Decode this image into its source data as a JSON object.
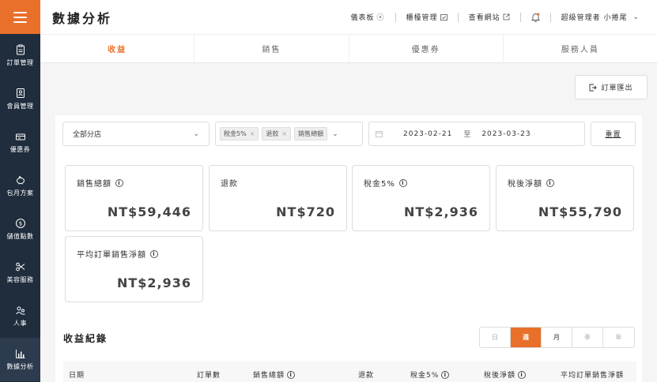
{
  "sidebar": {
    "items": [
      {
        "label": "訂單管理",
        "icon": "clipboard-icon"
      },
      {
        "label": "會員管理",
        "icon": "member-card-icon"
      },
      {
        "label": "優惠券",
        "icon": "coupon-icon"
      },
      {
        "label": "包月方案",
        "icon": "piggy-bank-icon"
      },
      {
        "label": "儲值點數",
        "icon": "dollar-coin-icon"
      },
      {
        "label": "美容服務",
        "icon": "scissors-icon"
      },
      {
        "label": "人事",
        "icon": "people-icon"
      },
      {
        "label": "數據分析",
        "icon": "bar-chart-icon"
      }
    ],
    "active_index": 7
  },
  "header": {
    "title": "數據分析",
    "links": [
      {
        "label": "儀表板",
        "icon": "help-circle-icon"
      },
      {
        "label": "櫃檯管理",
        "icon": "calendar-check-icon"
      },
      {
        "label": "查看網站",
        "icon": "external-link-icon"
      }
    ],
    "user": "超級管理者 小捲尾"
  },
  "tabs": [
    "收益",
    "銷售",
    "優惠券",
    "服務人員"
  ],
  "active_tab": 0,
  "export_label": "訂單匯出",
  "filters": {
    "store": "全部分店",
    "tags": [
      "稅金5%",
      "退款",
      "銷售總額"
    ],
    "date_start": "2023-02-21",
    "date_sep": "至",
    "date_end": "2023-03-23",
    "reset": "重置"
  },
  "stats": [
    {
      "label": "銷售總額",
      "value": "NT$59,446",
      "info": true
    },
    {
      "label": "退款",
      "value": "NT$720",
      "info": false
    },
    {
      "label": "稅金5%",
      "value": "NT$2,936",
      "info": true
    },
    {
      "label": "稅後淨額",
      "value": "NT$55,790",
      "info": true
    },
    {
      "label": "平均訂單銷售淨額",
      "value": "NT$2,936",
      "info": true
    }
  ],
  "records": {
    "title": "收益紀錄",
    "periods": [
      "日",
      "週",
      "月",
      "季",
      "年"
    ],
    "active_period": 1,
    "columns": [
      {
        "label": "日期",
        "info": false
      },
      {
        "label": "訂單數",
        "info": false
      },
      {
        "label": "銷售總額",
        "info": true
      },
      {
        "label": "退款",
        "info": false
      },
      {
        "label": "稅金5%",
        "info": true
      },
      {
        "label": "稅後淨額",
        "info": true
      },
      {
        "label": "平均訂單銷售淨額",
        "info": false
      }
    ]
  },
  "colors": {
    "accent": "#e8702a",
    "sidebar": "#1f2d3d"
  }
}
